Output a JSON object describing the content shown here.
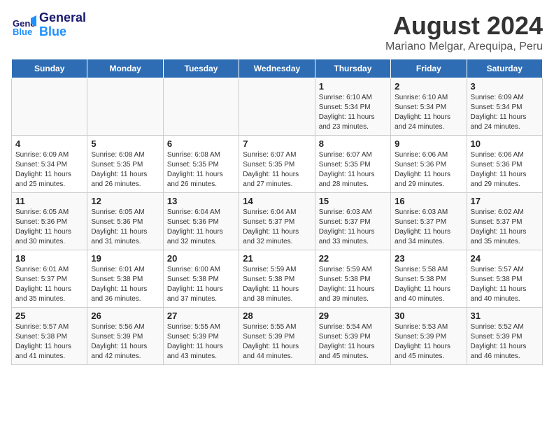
{
  "header": {
    "logo_line1": "General",
    "logo_line2": "Blue",
    "main_title": "August 2024",
    "subtitle": "Mariano Melgar, Arequipa, Peru"
  },
  "days_of_week": [
    "Sunday",
    "Monday",
    "Tuesday",
    "Wednesday",
    "Thursday",
    "Friday",
    "Saturday"
  ],
  "weeks": [
    [
      {
        "day": "",
        "info": ""
      },
      {
        "day": "",
        "info": ""
      },
      {
        "day": "",
        "info": ""
      },
      {
        "day": "",
        "info": ""
      },
      {
        "day": "1",
        "info": "Sunrise: 6:10 AM\nSunset: 5:34 PM\nDaylight: 11 hours and 23 minutes."
      },
      {
        "day": "2",
        "info": "Sunrise: 6:10 AM\nSunset: 5:34 PM\nDaylight: 11 hours and 24 minutes."
      },
      {
        "day": "3",
        "info": "Sunrise: 6:09 AM\nSunset: 5:34 PM\nDaylight: 11 hours and 24 minutes."
      }
    ],
    [
      {
        "day": "4",
        "info": "Sunrise: 6:09 AM\nSunset: 5:34 PM\nDaylight: 11 hours and 25 minutes."
      },
      {
        "day": "5",
        "info": "Sunrise: 6:08 AM\nSunset: 5:35 PM\nDaylight: 11 hours and 26 minutes."
      },
      {
        "day": "6",
        "info": "Sunrise: 6:08 AM\nSunset: 5:35 PM\nDaylight: 11 hours and 26 minutes."
      },
      {
        "day": "7",
        "info": "Sunrise: 6:07 AM\nSunset: 5:35 PM\nDaylight: 11 hours and 27 minutes."
      },
      {
        "day": "8",
        "info": "Sunrise: 6:07 AM\nSunset: 5:35 PM\nDaylight: 11 hours and 28 minutes."
      },
      {
        "day": "9",
        "info": "Sunrise: 6:06 AM\nSunset: 5:36 PM\nDaylight: 11 hours and 29 minutes."
      },
      {
        "day": "10",
        "info": "Sunrise: 6:06 AM\nSunset: 5:36 PM\nDaylight: 11 hours and 29 minutes."
      }
    ],
    [
      {
        "day": "11",
        "info": "Sunrise: 6:05 AM\nSunset: 5:36 PM\nDaylight: 11 hours and 30 minutes."
      },
      {
        "day": "12",
        "info": "Sunrise: 6:05 AM\nSunset: 5:36 PM\nDaylight: 11 hours and 31 minutes."
      },
      {
        "day": "13",
        "info": "Sunrise: 6:04 AM\nSunset: 5:36 PM\nDaylight: 11 hours and 32 minutes."
      },
      {
        "day": "14",
        "info": "Sunrise: 6:04 AM\nSunset: 5:37 PM\nDaylight: 11 hours and 32 minutes."
      },
      {
        "day": "15",
        "info": "Sunrise: 6:03 AM\nSunset: 5:37 PM\nDaylight: 11 hours and 33 minutes."
      },
      {
        "day": "16",
        "info": "Sunrise: 6:03 AM\nSunset: 5:37 PM\nDaylight: 11 hours and 34 minutes."
      },
      {
        "day": "17",
        "info": "Sunrise: 6:02 AM\nSunset: 5:37 PM\nDaylight: 11 hours and 35 minutes."
      }
    ],
    [
      {
        "day": "18",
        "info": "Sunrise: 6:01 AM\nSunset: 5:37 PM\nDaylight: 11 hours and 35 minutes."
      },
      {
        "day": "19",
        "info": "Sunrise: 6:01 AM\nSunset: 5:38 PM\nDaylight: 11 hours and 36 minutes."
      },
      {
        "day": "20",
        "info": "Sunrise: 6:00 AM\nSunset: 5:38 PM\nDaylight: 11 hours and 37 minutes."
      },
      {
        "day": "21",
        "info": "Sunrise: 5:59 AM\nSunset: 5:38 PM\nDaylight: 11 hours and 38 minutes."
      },
      {
        "day": "22",
        "info": "Sunrise: 5:59 AM\nSunset: 5:38 PM\nDaylight: 11 hours and 39 minutes."
      },
      {
        "day": "23",
        "info": "Sunrise: 5:58 AM\nSunset: 5:38 PM\nDaylight: 11 hours and 40 minutes."
      },
      {
        "day": "24",
        "info": "Sunrise: 5:57 AM\nSunset: 5:38 PM\nDaylight: 11 hours and 40 minutes."
      }
    ],
    [
      {
        "day": "25",
        "info": "Sunrise: 5:57 AM\nSunset: 5:38 PM\nDaylight: 11 hours and 41 minutes."
      },
      {
        "day": "26",
        "info": "Sunrise: 5:56 AM\nSunset: 5:39 PM\nDaylight: 11 hours and 42 minutes."
      },
      {
        "day": "27",
        "info": "Sunrise: 5:55 AM\nSunset: 5:39 PM\nDaylight: 11 hours and 43 minutes."
      },
      {
        "day": "28",
        "info": "Sunrise: 5:55 AM\nSunset: 5:39 PM\nDaylight: 11 hours and 44 minutes."
      },
      {
        "day": "29",
        "info": "Sunrise: 5:54 AM\nSunset: 5:39 PM\nDaylight: 11 hours and 45 minutes."
      },
      {
        "day": "30",
        "info": "Sunrise: 5:53 AM\nSunset: 5:39 PM\nDaylight: 11 hours and 45 minutes."
      },
      {
        "day": "31",
        "info": "Sunrise: 5:52 AM\nSunset: 5:39 PM\nDaylight: 11 hours and 46 minutes."
      }
    ]
  ]
}
